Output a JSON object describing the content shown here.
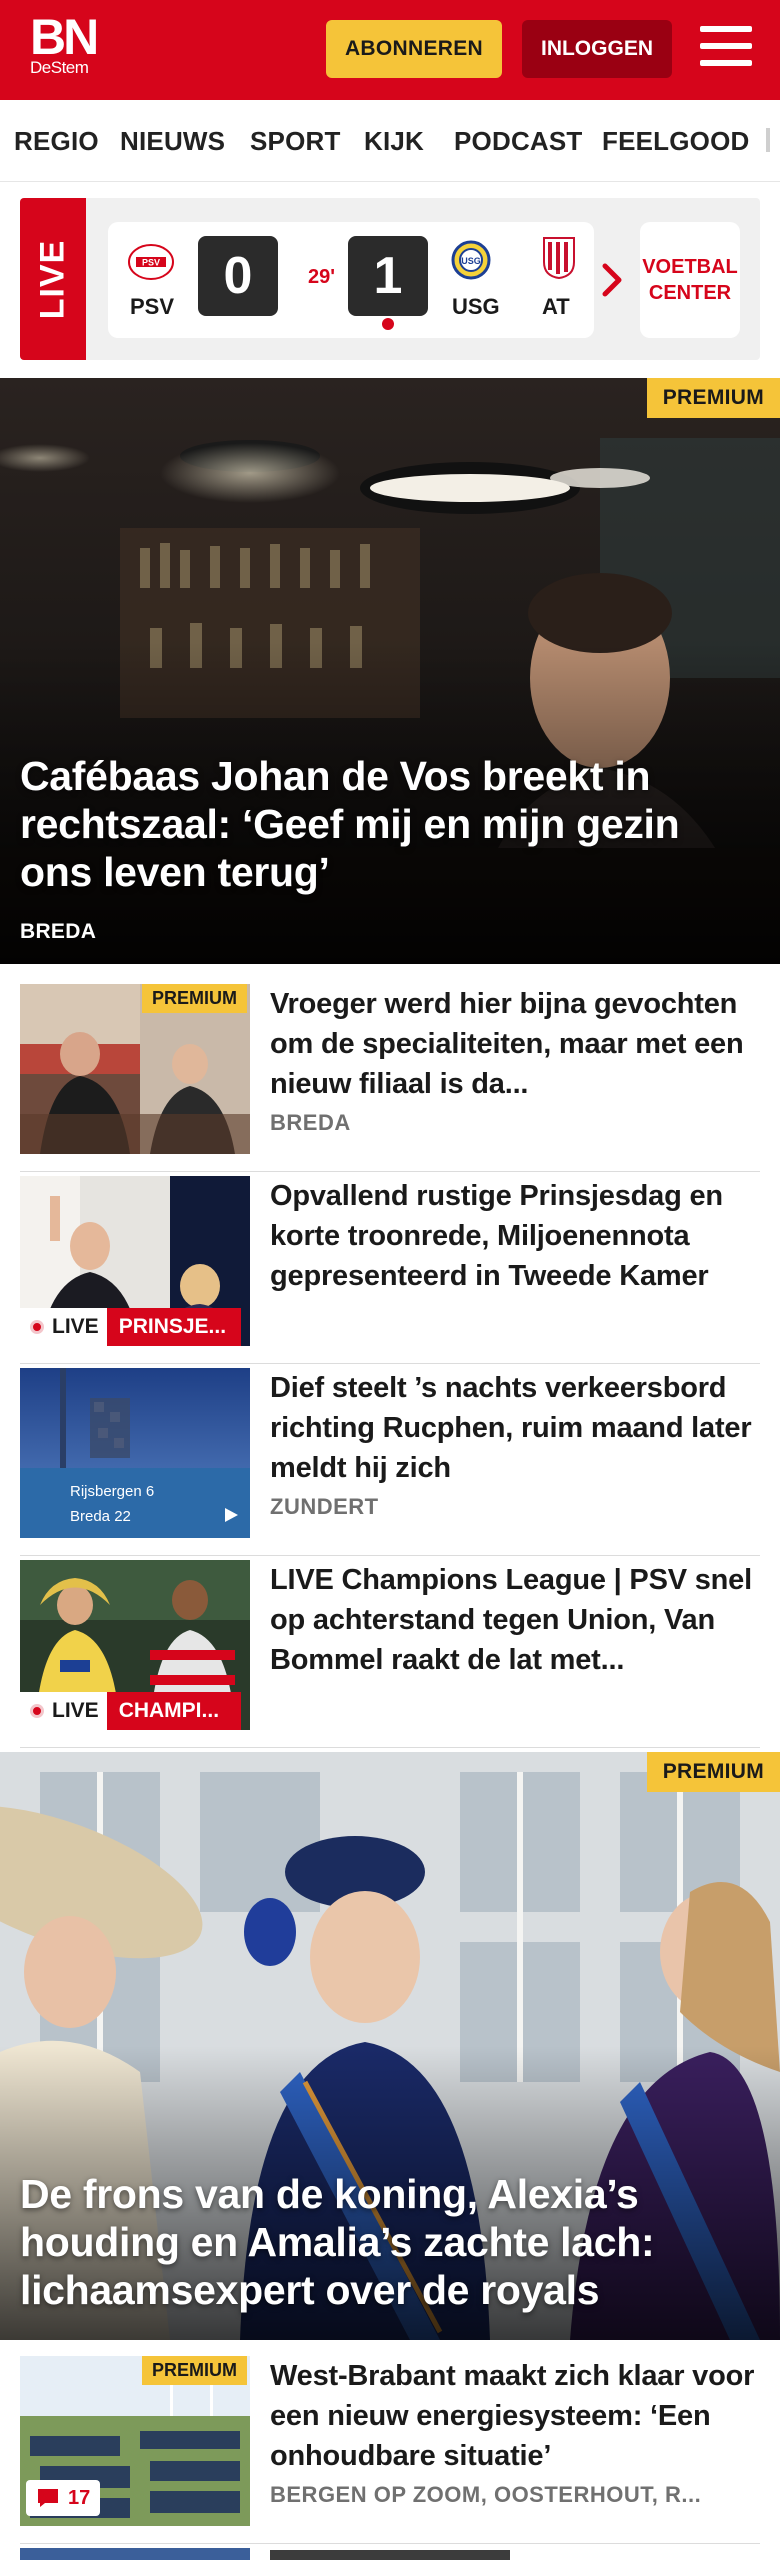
{
  "header": {
    "logo_main": "BN",
    "logo_sub": "DeStem",
    "subscribe_label": "ABONNEREN",
    "login_label": "INLOGGEN",
    "brand_color": "#d6051b",
    "menu_icon": "hamburger-menu-icon"
  },
  "nav": {
    "items": [
      "REGIO",
      "NIEUWS",
      "SPORT",
      "KIJK",
      "PODCAST",
      "FEELGOOD"
    ]
  },
  "livebar": {
    "live_label": "LIVE",
    "match": {
      "home_team": "PSV",
      "home_score": "0",
      "minute": "29'",
      "away_score": "1",
      "away_team": "USG"
    },
    "next_team": "AT",
    "voetbal_center_label": "VOETBAL CENTER"
  },
  "hero1": {
    "badge": "PREMIUM",
    "title": "Cafébaas Johan de Vos breekt in rechtszaal: ‘Geef mij en mijn gezin ons leven terug’",
    "label": "BREDA"
  },
  "articles": [
    {
      "badge": "PREMIUM",
      "title": "Vroeger werd hier bijna gevochten om de specialiteiten, maar met een nieuw filiaal is da...",
      "sub": "BREDA"
    },
    {
      "live": "LIVE",
      "live_topic": "PRINSJE...",
      "title": "Opvallend rustige Prinsjesdag en korte troonrede, Miljoenennota gepresenteerd in Tweede Kamer"
    },
    {
      "title": "Dief steelt ’s nachts verkeers­bord richting Rucphen, ruim maand later meldt hij zich",
      "sub": "ZUNDERT",
      "sign_line1": "Rijsbergen 6",
      "sign_line2": "Breda 22"
    },
    {
      "live": "LIVE",
      "live_topic": "CHAMPI...",
      "title": "LIVE Champions League | PSV snel op achterstand tegen Union, Van Bommel raakt de lat met..."
    }
  ],
  "hero2": {
    "badge": "PREMIUM",
    "title": "De frons van de koning, Alexia’s houding en Amalia’s zachte lach: lichaamsexpert over de royals"
  },
  "article5": {
    "badge": "PREMIUM",
    "title": "West-Brabant maakt zich klaar voor een nieuw energiesysteem: ‘Een onhoudbare situatie’",
    "sub": "BERGEN OP ZOOM, OOSTERHOUT, R...",
    "comments": "17"
  }
}
